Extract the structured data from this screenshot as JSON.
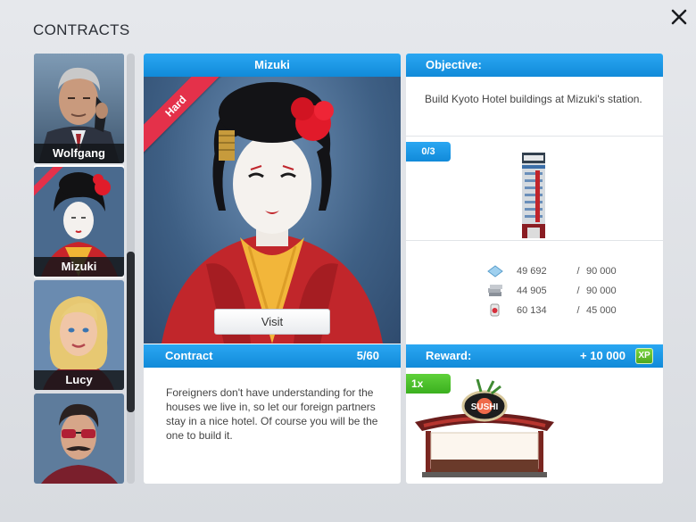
{
  "window": {
    "title": "CONTRACTS",
    "close_icon": "close-icon"
  },
  "sidebar": {
    "characters": [
      {
        "name": "Wolfgang",
        "selected": false,
        "ribbon": false
      },
      {
        "name": "Mizuki",
        "selected": true,
        "ribbon": true
      },
      {
        "name": "Lucy",
        "selected": false,
        "ribbon": false
      },
      {
        "name": "",
        "selected": false,
        "ribbon": false
      }
    ]
  },
  "character_panel": {
    "name": "Mizuki",
    "difficulty": "Hard",
    "visit_label": "Visit",
    "contract_label": "Contract",
    "contract_progress": "5/60",
    "description": "Foreigners don't have understanding for the houses we live in, so let our foreign partners stay in a nice hotel. Of course you will be the one to build it."
  },
  "objective_panel": {
    "header": "Objective:",
    "text": "Build Kyoto Hotel buildings at Mizuki's station.",
    "counter": "0/3",
    "building_icon": "hotel-building-icon",
    "resources": [
      {
        "icon": "glass-icon",
        "current": "49 692",
        "sep": "/",
        "required": "90 000"
      },
      {
        "icon": "steel-icon",
        "current": "44 905",
        "sep": "/",
        "required": "90 000"
      },
      {
        "icon": "lamp-icon",
        "current": "60 134",
        "sep": "/",
        "required": "45 000"
      }
    ],
    "reward_label": "Reward:",
    "reward_xp": "+ 10 000",
    "xp_label": "XP",
    "reward_quantity": "1x",
    "reward_item_icon": "sushi-stand-icon"
  },
  "colors": {
    "accent_blue": "#118ad9",
    "ribbon_red": "#e4314a",
    "xp_green": "#4ea81f"
  }
}
